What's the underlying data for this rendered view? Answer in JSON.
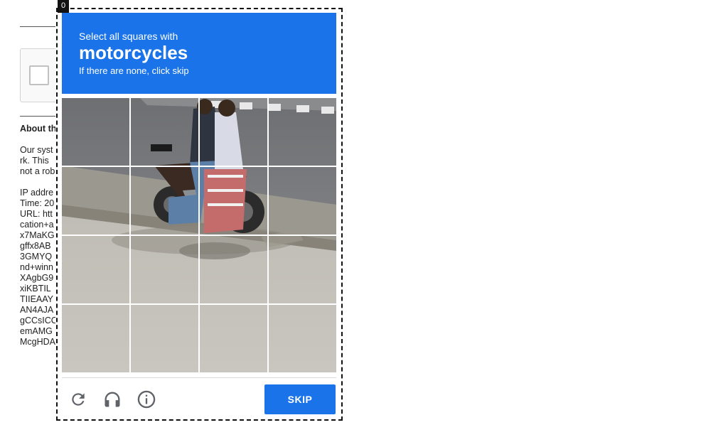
{
  "popup": {
    "corner_label": "0",
    "header": {
      "instruction": "Select all squares with",
      "target": "motorcycles",
      "hint": "If there are none, click skip"
    },
    "grid": {
      "rows": 4,
      "columns": 4
    },
    "footer": {
      "reload_icon": "reload-icon",
      "audio_icon": "headphones-icon",
      "info_icon": "info-icon",
      "skip_label": "SKIP"
    },
    "accent_color": "#1a73e8"
  },
  "background": {
    "heading": "About th",
    "paragraph_lines": [
      "Our syst",
      "rk. This",
      "not a rob"
    ],
    "info_lines": [
      "IP addre",
      "Time: 20",
      "URL: htt",
      "cation+a",
      "x7MaKG",
      "gffx8AB",
      "3GMYQ",
      "nd+winn",
      "XAgbG9",
      "xiKBTIL",
      "TIIEAAY",
      "AN4AJA",
      "gCCsICC",
      "emAMG",
      "McgHDA"
    ]
  }
}
